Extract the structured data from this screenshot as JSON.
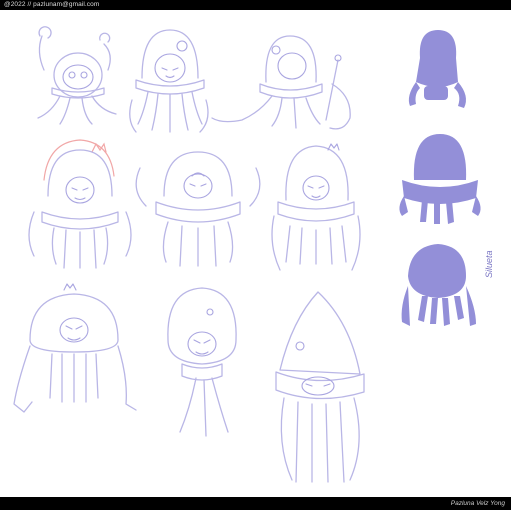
{
  "header": {
    "credit": "@2022 // pazlunam@gmail.com"
  },
  "footer": {
    "signature": "Pazluna Velz Yong"
  },
  "sheet": {
    "silhouette_label": "Silueta",
    "colors": {
      "line": "#b9b6e6",
      "silhouette": "#938fd8",
      "accent": "#f1a7a7"
    }
  }
}
